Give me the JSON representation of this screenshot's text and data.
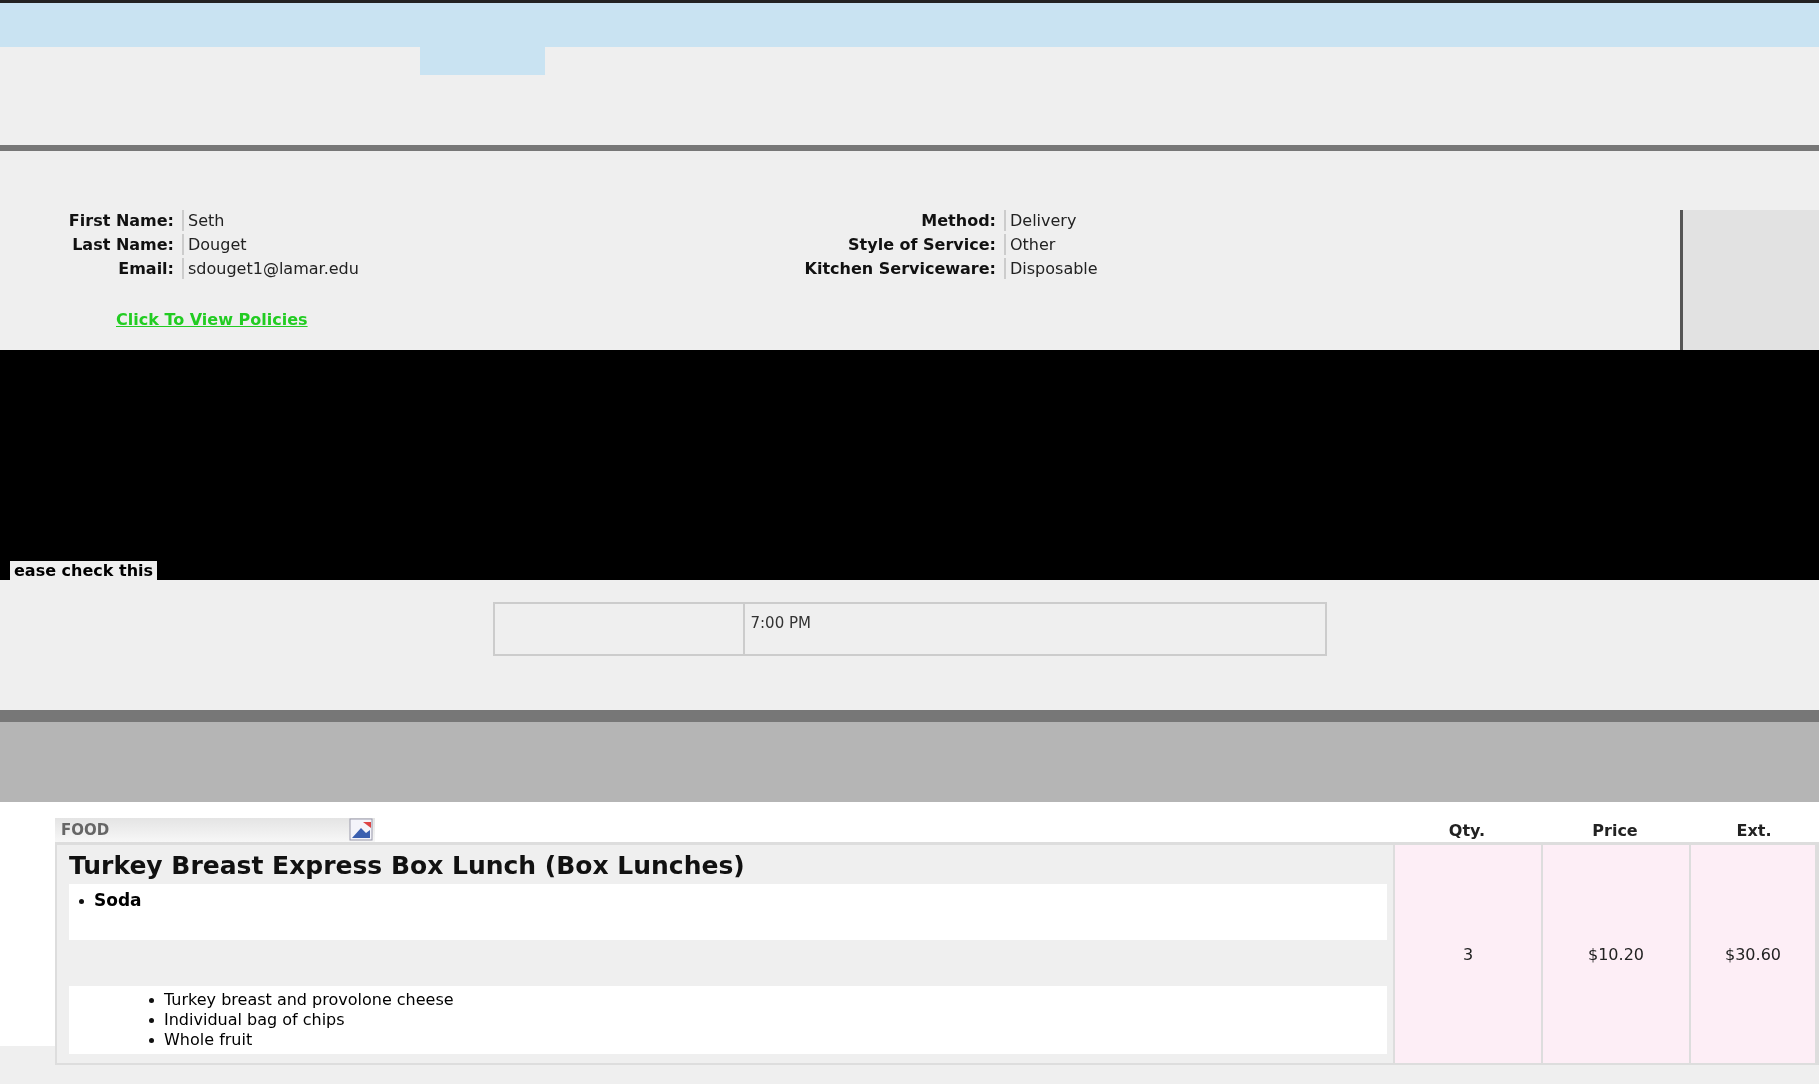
{
  "customer": {
    "fields": [
      {
        "label": "First Name:",
        "value": "Seth"
      },
      {
        "label": "Last Name:",
        "value": "Douget"
      },
      {
        "label": "Email:",
        "value": "sdouget1@lamar.edu"
      }
    ],
    "link": "Click To View Policies"
  },
  "service": {
    "fields": [
      {
        "label": "Method:",
        "value": "Delivery"
      },
      {
        "label": "Style of Service:",
        "value": "Other"
      },
      {
        "label": "Kitchen Serviceware:",
        "value": "Disposable"
      }
    ]
  },
  "notice": "ease check this",
  "time": {
    "value": "7:00 PM"
  },
  "food": {
    "heading": "FOOD",
    "columns": [
      "Qty.",
      "Price",
      "Ext."
    ],
    "items": [
      {
        "name": "Turkey Breast Express Box Lunch (Box Lunches)",
        "option": "Soda",
        "details": [
          "Turkey breast and provolone cheese",
          "Individual bag of chips",
          "Whole fruit"
        ],
        "qty": "3",
        "price": "$10.20",
        "ext": "$30.60"
      }
    ]
  }
}
